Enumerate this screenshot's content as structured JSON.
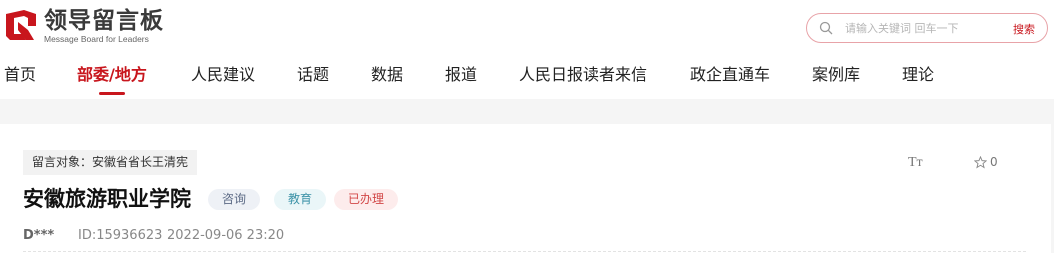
{
  "brand": {
    "name_cn": "领导留言板",
    "name_en": "Message Board for Leaders",
    "brand_color": "#c8161d"
  },
  "search": {
    "placeholder": "请输入关键词 回车一下",
    "button_label": "搜索",
    "icon": "search-icon"
  },
  "nav": {
    "items": [
      {
        "label": "首页",
        "active": false
      },
      {
        "label": "部委/地方",
        "active": true
      },
      {
        "label": "人民建议",
        "active": false
      },
      {
        "label": "话题",
        "active": false
      },
      {
        "label": "数据",
        "active": false
      },
      {
        "label": "报道",
        "active": false
      },
      {
        "label": "人民日报读者来信",
        "active": false
      },
      {
        "label": "政企直通车",
        "active": false
      },
      {
        "label": "案例库",
        "active": false
      },
      {
        "label": "理论",
        "active": false
      }
    ]
  },
  "message": {
    "target": "留言对象：安徽省省长王清宪",
    "title": "安徽旅游职业学院",
    "tags": {
      "type": "咨询",
      "category": "教育",
      "status": "已办理"
    },
    "author": "D***",
    "id_text": "ID:15936623",
    "time": "2022-09-06 23:20",
    "fontsize_label": "Tт",
    "favorite_count": "0"
  }
}
